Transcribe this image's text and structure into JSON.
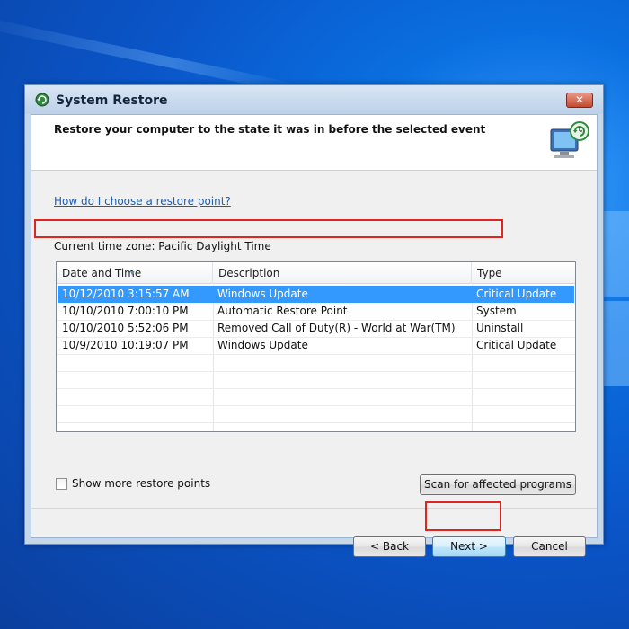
{
  "window": {
    "title": "System Restore",
    "close_glyph": "✕"
  },
  "header": {
    "text": "Restore your computer to the state it was in before the selected event",
    "icon": "system-restore-monitor-icon"
  },
  "help_link": "How do I choose a restore point?",
  "timezone_label": "Current time zone: Pacific Daylight Time",
  "list": {
    "columns": [
      "Date and Time",
      "Description",
      "Type"
    ],
    "rows": [
      {
        "date": "10/12/2010 3:15:57 AM",
        "description": "Windows Update",
        "type": "Critical Update",
        "selected": true
      },
      {
        "date": "10/10/2010 7:00:10 PM",
        "description": "Automatic Restore Point",
        "type": "System",
        "selected": false
      },
      {
        "date": "10/10/2010 5:52:06 PM",
        "description": "Removed Call of Duty(R) - World at War(TM)",
        "type": "Uninstall",
        "selected": false
      },
      {
        "date": "10/9/2010 10:19:07 PM",
        "description": "Windows Update",
        "type": "Critical Update",
        "selected": false
      }
    ]
  },
  "show_more_label": "Show more restore points",
  "show_more_checked": false,
  "buttons": {
    "scan": "Scan for affected programs",
    "back": "< Back",
    "next": "Next >",
    "cancel": "Cancel"
  },
  "colors": {
    "selection": "#3399ff",
    "annotation_red": "#e0241f",
    "desktop_blue": "#0a6fe0"
  }
}
